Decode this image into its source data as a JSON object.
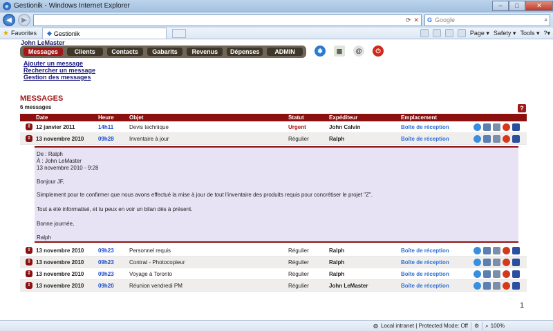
{
  "window": {
    "title": "Gestionik - Windows Internet Explorer"
  },
  "browser": {
    "search_placeholder": "Google",
    "favorites_label": "Favorites",
    "tab_label": "Gestionik",
    "cmd_page": "Page ▾",
    "cmd_safety": "Safety ▾",
    "cmd_tools": "Tools ▾",
    "cmd_help": "?▾"
  },
  "user": {
    "name": "John LeMaster"
  },
  "menu": [
    "Messages",
    "Clients",
    "Contacts",
    "Gabarits",
    "Revenus",
    "Dépenses",
    "ADMIN"
  ],
  "actions": [
    "Ajouter un message",
    "Rechercher un message",
    "Gestion des messages"
  ],
  "section": {
    "title": "MESSAGES",
    "count": "6 messages",
    "help": "?"
  },
  "table": {
    "headers": {
      "date": "Date",
      "heure": "Heure",
      "objet": "Objet",
      "statut": "Statut",
      "expediteur": "Expéditeur",
      "emplacement": "Emplacement"
    },
    "rows": [
      {
        "date": "12 janvier 2011",
        "heure": "14h11",
        "objet": "Devis technique",
        "statut": "Urgent",
        "expediteur": "John Calvin",
        "emplacement": "Boîte de réception"
      },
      {
        "date": "13 novembre 2010",
        "heure": "09h28",
        "objet": "Inventaire à jour",
        "statut": "Régulier",
        "expediteur": "Ralph",
        "emplacement": "Boîte de réception"
      },
      {
        "date": "13 novembre 2010",
        "heure": "09h23",
        "objet": "Personnel requis",
        "statut": "Régulier",
        "expediteur": "Ralph",
        "emplacement": "Boîte de réception"
      },
      {
        "date": "13 novembre 2010",
        "heure": "09h23",
        "objet": "Contrat - Photocopieur",
        "statut": "Régulier",
        "expediteur": "Ralph",
        "emplacement": "Boîte de réception"
      },
      {
        "date": "13 novembre 2010",
        "heure": "09h23",
        "objet": "Voyage à Toronto",
        "statut": "Régulier",
        "expediteur": "Ralph",
        "emplacement": "Boîte de réception"
      },
      {
        "date": "13 novembre 2010",
        "heure": "09h20",
        "objet": "Réunion vendredi PM",
        "statut": "Régulier",
        "expediteur": "John LeMaster",
        "emplacement": "Boîte de réception"
      }
    ]
  },
  "detail": {
    "from": "De : Ralph",
    "to": "À : John LeMaster",
    "sent": "13 novembre 2010 - 9:28",
    "greeting": "Bonjour JF,",
    "body1": "Simplement pour te confirmer que nous avons effectué la mise à jour de tout l'inventaire des produits requis pour concrétiser le projet \"Z\".",
    "body2": "Tout a été informatisé, et tu peux en voir un bilan dès à présent.",
    "closing": "Bonne journée,",
    "signature": "Ralph"
  },
  "pagination": {
    "page": "1"
  },
  "statusbar": {
    "zone": "Local intranet | Protected Mode: Off",
    "zoom": "100%"
  },
  "colors": {
    "brand_red": "#8c1010",
    "link_blue": "#2f6fd6",
    "detail_bg": "#e7e2f4"
  }
}
